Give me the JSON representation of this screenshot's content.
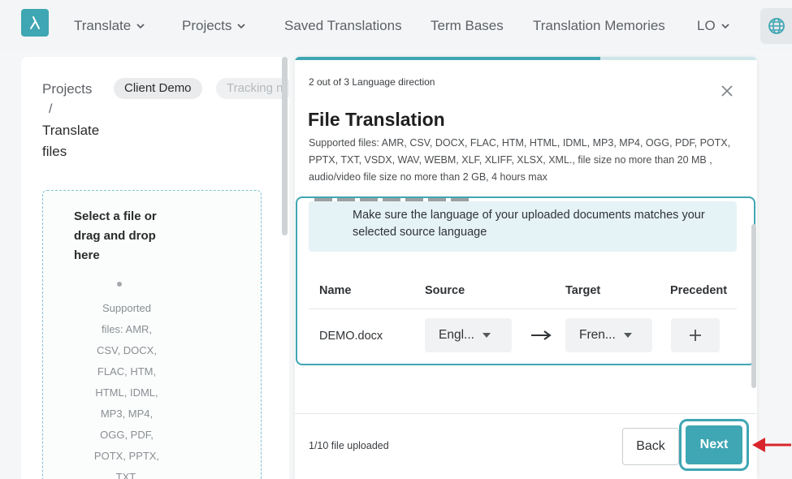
{
  "nav": {
    "items": [
      {
        "label": "Translate",
        "has_dropdown": true
      },
      {
        "label": "Projects",
        "has_dropdown": true
      },
      {
        "label": "Saved Translations",
        "has_dropdown": false
      },
      {
        "label": "Term Bases",
        "has_dropdown": false
      },
      {
        "label": "Translation Memories",
        "has_dropdown": false
      },
      {
        "label": "LO",
        "has_dropdown": true
      }
    ],
    "logo_icon": "logo-lambda-icon",
    "globe_icon": "globe-icon"
  },
  "breadcrumb": {
    "root": "Projects",
    "chips": [
      "Client Demo",
      "Tracking n"
    ],
    "separator": "/",
    "current": "Translate files"
  },
  "dropzone": {
    "title": "Select a file or drag and drop here",
    "supported": "Supported files: AMR, CSV, DOCX, FLAC, HTM, HTML, IDML, MP3, MP4, OGG, PDF, POTX, PPTX, TXT,"
  },
  "modal": {
    "step": "2 out of 3 Language direction",
    "step_progress": 0.66,
    "title": "File Translation",
    "supported_files": "Supported files: AMR, CSV, DOCX, FLAC, HTM, HTML, IDML, MP3, MP4, OGG, PDF, POTX, PPTX, TXT, VSDX, WAV, WEBM, XLF, XLIFF, XLSX, XML., file size no more than 20 MB , audio/video file size no more than 2 GB, 4 hours max",
    "notice": "Make sure the language of your uploaded documents matches your selected source language",
    "table": {
      "headers": {
        "name": "Name",
        "source": "Source",
        "target": "Target",
        "precedent": "Precedent"
      },
      "rows": [
        {
          "name": "DEMO.docx",
          "source": "Engl...",
          "target": "Fren..."
        }
      ]
    },
    "upload_status": "1/10 file uploaded",
    "back_label": "Back",
    "next_label": "Next"
  },
  "colors": {
    "accent": "#3fa6b3",
    "annotation_arrow": "#d9262c"
  }
}
